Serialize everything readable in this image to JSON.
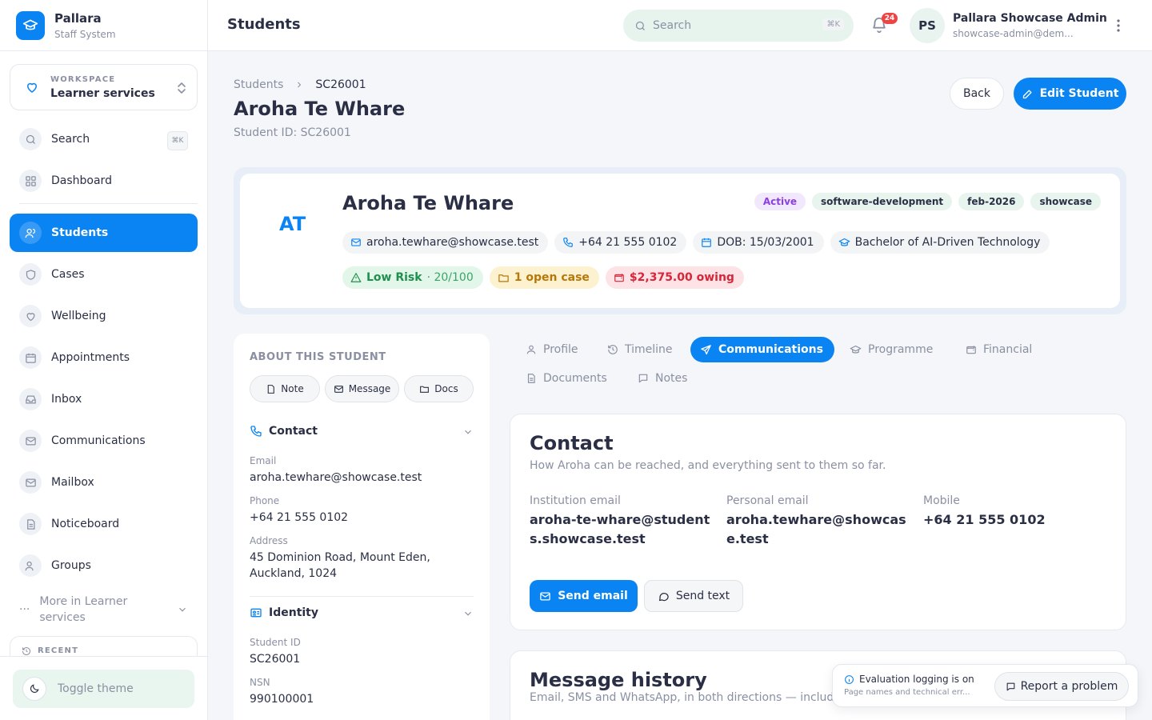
{
  "app": {
    "name": "Pallara",
    "subtitle": "Staff System"
  },
  "workspace": {
    "label": "WORKSPACE",
    "name": "Learner services"
  },
  "sidebar": {
    "search_label": "Search",
    "search_shortcut": "⌘K",
    "items": [
      {
        "label": "Dashboard"
      },
      {
        "label": "Students"
      },
      {
        "label": "Cases"
      },
      {
        "label": "Wellbeing"
      },
      {
        "label": "Appointments"
      },
      {
        "label": "Inbox"
      },
      {
        "label": "Communications"
      },
      {
        "label": "Mailbox"
      },
      {
        "label": "Noticeboard"
      },
      {
        "label": "Groups"
      }
    ],
    "more_label": "More in Learner services",
    "recent_label": "RECENT",
    "toggle_theme": "Toggle theme"
  },
  "header": {
    "title": "Students",
    "search_placeholder": "Search",
    "search_shortcut": "⌘K",
    "notification_count": "24",
    "user_initials": "PS",
    "user_name": "Pallara Showcase Admin",
    "user_email": "showcase-admin@dem..."
  },
  "breadcrumb": {
    "root": "Students",
    "current": "SC26001"
  },
  "page": {
    "student_name": "Aroha Te Whare",
    "student_id_text": "Student ID: SC26001",
    "back_label": "Back",
    "edit_label": "Edit Student"
  },
  "profile": {
    "initials": "AT",
    "name": "Aroha Te Whare",
    "tags": [
      "Active",
      "software-development",
      "feb-2026",
      "showcase"
    ],
    "email": "aroha.tewhare@showcase.test",
    "phone": "+64 21 555 0102",
    "dob": "DOB: 15/03/2001",
    "programme": "Bachelor of AI-Driven Technology",
    "risk_label": "Low Risk",
    "risk_score": "· 20/100",
    "cases": "1 open case",
    "owing": "$2,375.00 owing",
    "colors": {
      "accent": "#0b84f3",
      "risk": "#1f8f4e",
      "cases": "#b7780a",
      "owing": "#d6263a",
      "active_tag": "#8b3fe0"
    }
  },
  "about": {
    "title": "ABOUT THIS STUDENT",
    "buttons": [
      "Note",
      "Message",
      "Docs"
    ],
    "contact_heading": "Contact",
    "email_label": "Email",
    "email_value": "aroha.tewhare@showcase.test",
    "phone_label": "Phone",
    "phone_value": "+64 21 555 0102",
    "address_label": "Address",
    "address_value": "45 Dominion Road, Mount Eden, Auckland, 1024",
    "identity_heading": "Identity",
    "student_id_label": "Student ID",
    "student_id_value": "SC26001",
    "nsn_label": "NSN",
    "nsn_value": "990100001"
  },
  "tabs": [
    "Profile",
    "Timeline",
    "Communications",
    "Programme",
    "Financial",
    "Documents",
    "Notes"
  ],
  "active_tab": "Communications",
  "contact_card": {
    "title": "Contact",
    "subtitle": "How Aroha can be reached, and everything sent to them so far.",
    "institution_label": "Institution email",
    "institution_value": "aroha-te-whare@students.showcase.test",
    "personal_label": "Personal email",
    "personal_value": "aroha.tewhare@showcase.test",
    "mobile_label": "Mobile",
    "mobile_value": "+64 21 555 0102",
    "send_email": "Send email",
    "send_text": "Send text"
  },
  "history": {
    "title": "Message history",
    "subtitle": "Email, SMS and WhatsApp, in both directions — includin"
  },
  "toast": {
    "title": "Evaluation logging is on",
    "subtitle": "Page names and technical err...",
    "report_label": "Report a problem"
  }
}
